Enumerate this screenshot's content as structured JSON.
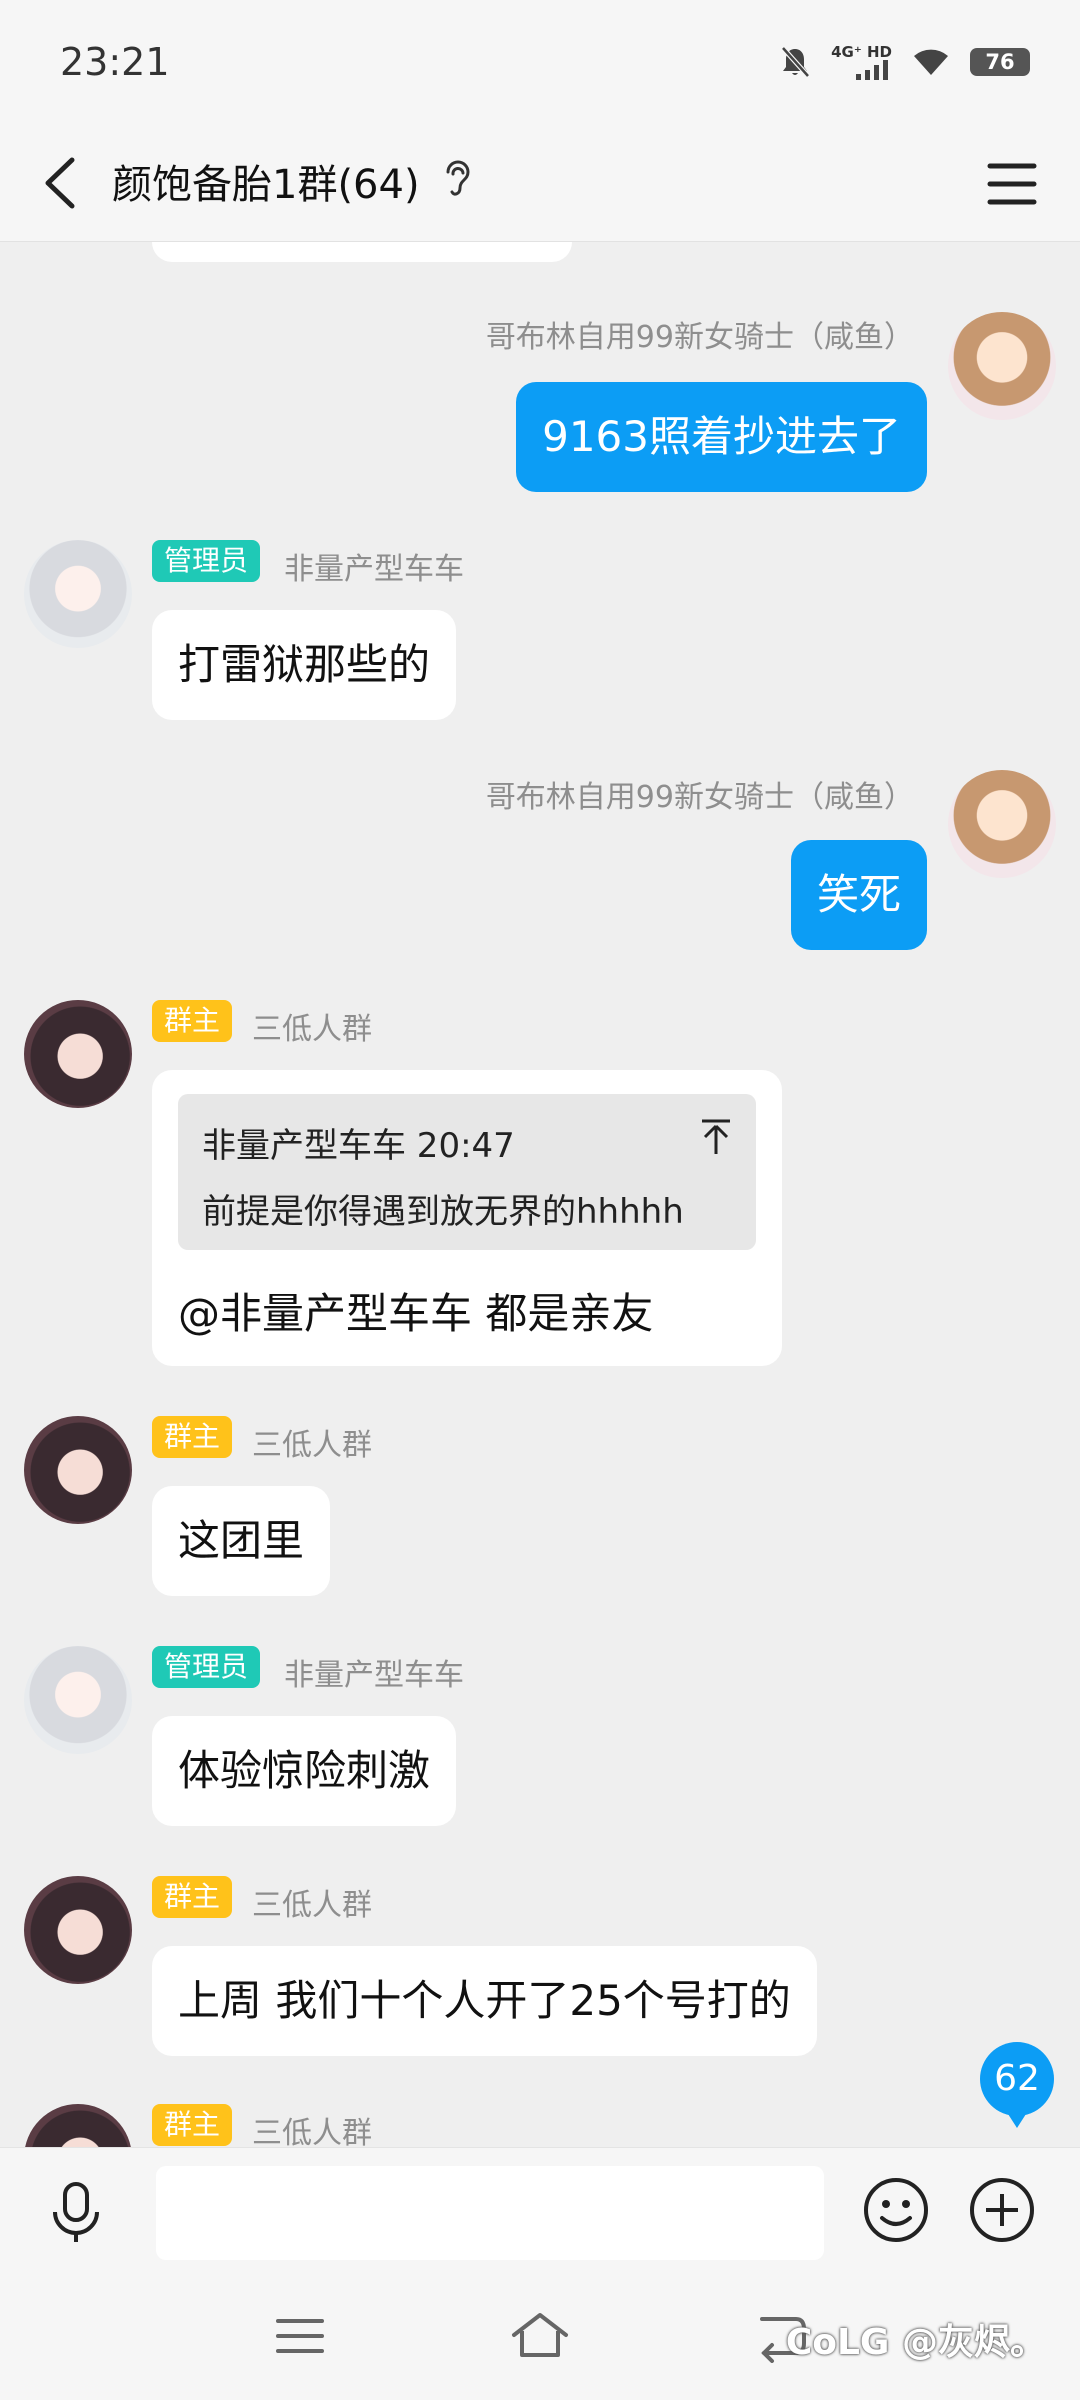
{
  "status_bar": {
    "time": "23:21",
    "network_label": "4G⁺ HD",
    "battery": "76"
  },
  "header": {
    "title": "颜饱备胎1群(64)"
  },
  "messages": [
    {
      "sender": "哥布林自用99新女骑士（咸鱼）",
      "text": "9163照着抄进去了",
      "mine": true
    },
    {
      "badge": "管理员",
      "sender": "非量产型车车",
      "text": "打雷狱那些的"
    },
    {
      "sender": "哥布林自用99新女骑士（咸鱼）",
      "text": "笑死",
      "mine": true
    },
    {
      "badge": "群主",
      "sender": "三低人群",
      "quote_header": "非量产型车车 20:47",
      "quote_text": "前提是你得遇到放无界的hhhhh",
      "text": "@非量产型车车 都是亲友"
    },
    {
      "badge": "群主",
      "sender": "三低人群",
      "text": "这团里"
    },
    {
      "badge": "管理员",
      "sender": "非量产型车车",
      "text": "体验惊险刺激"
    },
    {
      "badge": "群主",
      "sender": "三低人群",
      "text": "上周 我们十个人开了25个号打的"
    },
    {
      "badge": "群主",
      "sender": "三低人群"
    }
  ],
  "unread_count": "62",
  "input": {
    "value": "",
    "placeholder": ""
  },
  "watermark": "CoLG @灰烬。",
  "colors": {
    "accent": "#0c9df5",
    "admin_badge": "#1fc9b6",
    "owner_badge": "#ffc21a",
    "background": "#efefef"
  },
  "icons": [
    "back-arrow-icon",
    "ear-icon",
    "menu-icon",
    "mute-bell-icon",
    "signal-icon",
    "wifi-icon",
    "microphone-icon",
    "emoji-icon",
    "plus-icon",
    "nav-menu-icon",
    "nav-home-icon",
    "nav-back-icon"
  ]
}
